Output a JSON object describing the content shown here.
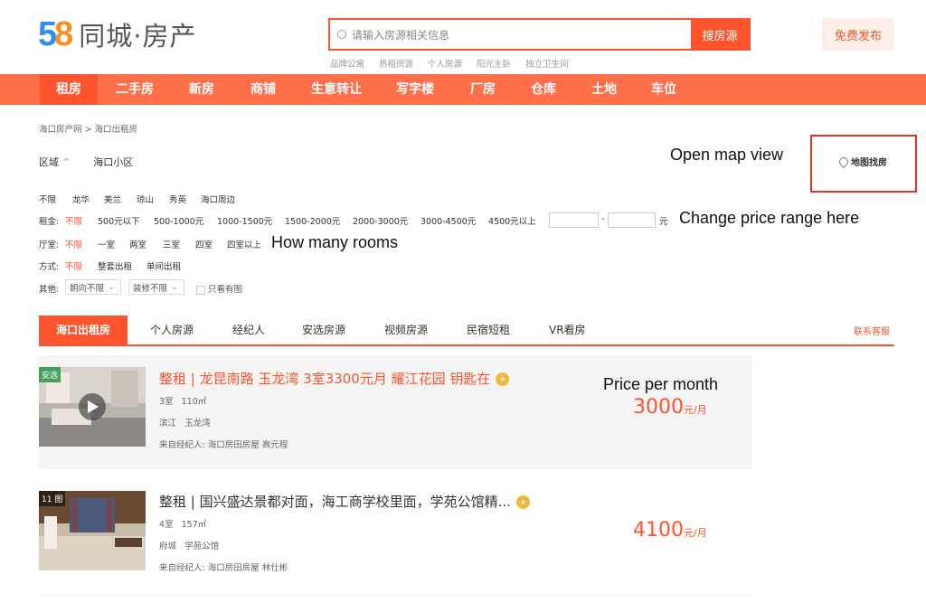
{
  "header": {
    "logo_58": "58",
    "logo_text": "同城·房产",
    "search_placeholder": "请输入房源相关信息",
    "search_button": "搜房源",
    "hot_links": [
      "品牌公寓",
      "热租房源",
      "个人房源",
      "阳光主卧",
      "独立卫生间"
    ],
    "publish_button": "免费发布"
  },
  "nav": {
    "items": [
      "租房",
      "二手房",
      "新房",
      "商铺",
      "生意转让",
      "写字楼",
      "厂房",
      "仓库",
      "土地",
      "车位"
    ],
    "active": "租房"
  },
  "breadcrumb": "海口房产网 > 海口出租房",
  "filters": {
    "area_label": "区域",
    "area_caret": "^",
    "community_label": "海口小区",
    "districts": [
      "不限",
      "龙华",
      "美兰",
      "琼山",
      "秀英",
      "海口周边"
    ],
    "rent_label": "租金:",
    "rent_options": [
      "不限",
      "500元以下",
      "500-1000元",
      "1000-1500元",
      "1500-2000元",
      "2000-3000元",
      "3000-4500元",
      "4500元以上"
    ],
    "rent_dash": "-",
    "rent_unit": "元",
    "room_label": "厅室:",
    "room_options": [
      "不限",
      "一室",
      "两室",
      "三室",
      "四室",
      "四室以上"
    ],
    "method_label": "方式:",
    "method_options": [
      "不限",
      "整套出租",
      "单间出租"
    ],
    "other_label": "其他:",
    "orientation_select": "朝向不限",
    "decor_select": "装修不限",
    "only_pics": "只看有图"
  },
  "map_button": "地图找房",
  "annotations": {
    "map": "Open map view",
    "price": "Change price range here",
    "rooms": "How many rooms",
    "per_month": "Price per month"
  },
  "tabs": {
    "items": [
      "海口出租房",
      "个人房源",
      "经纪人",
      "安选房源",
      "视频房源",
      "民宿短租",
      "VR看房"
    ],
    "report": "联系客服"
  },
  "listings": [
    {
      "badge": "安选",
      "title": "整租 | 龙昆南路 玉龙湾 3室3300元月 耀江花园 钥匙在",
      "rooms": "3室",
      "area": "110㎡",
      "location": "滨江",
      "community": "玉龙湾",
      "agent": "来自经纪人: 海口房田房屋 高元程",
      "price": "3000",
      "unit": "元/月"
    },
    {
      "badge": "11 图",
      "title": "整租 | 国兴盛达景都对面，海工商学校里面，学苑公馆精...",
      "rooms": "4室",
      "area": "157㎡",
      "location": "府城",
      "community": "学苑公馆",
      "agent": "来自经纪人: 海口房田房屋 林仕彬",
      "price": "4100",
      "unit": "元/月"
    }
  ],
  "colors": {
    "brand": "#ff552e",
    "nav_bg": "#ff6f4a",
    "annotation_box": "#e0312b"
  }
}
